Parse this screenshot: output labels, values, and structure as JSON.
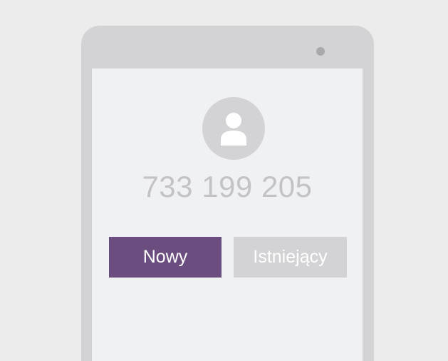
{
  "contact": {
    "avatar_icon": "user-icon",
    "phone_number": "733 199 205"
  },
  "actions": {
    "new_label": "Nowy",
    "existing_label": "Istniejący"
  },
  "colors": {
    "background": "#ececec",
    "phone_frame": "#d3d3d5",
    "screen": "#f0f1f3",
    "primary_button": "#6b4e7f",
    "secondary_button": "#d3d3d5",
    "number_text": "#c3c3c6"
  }
}
